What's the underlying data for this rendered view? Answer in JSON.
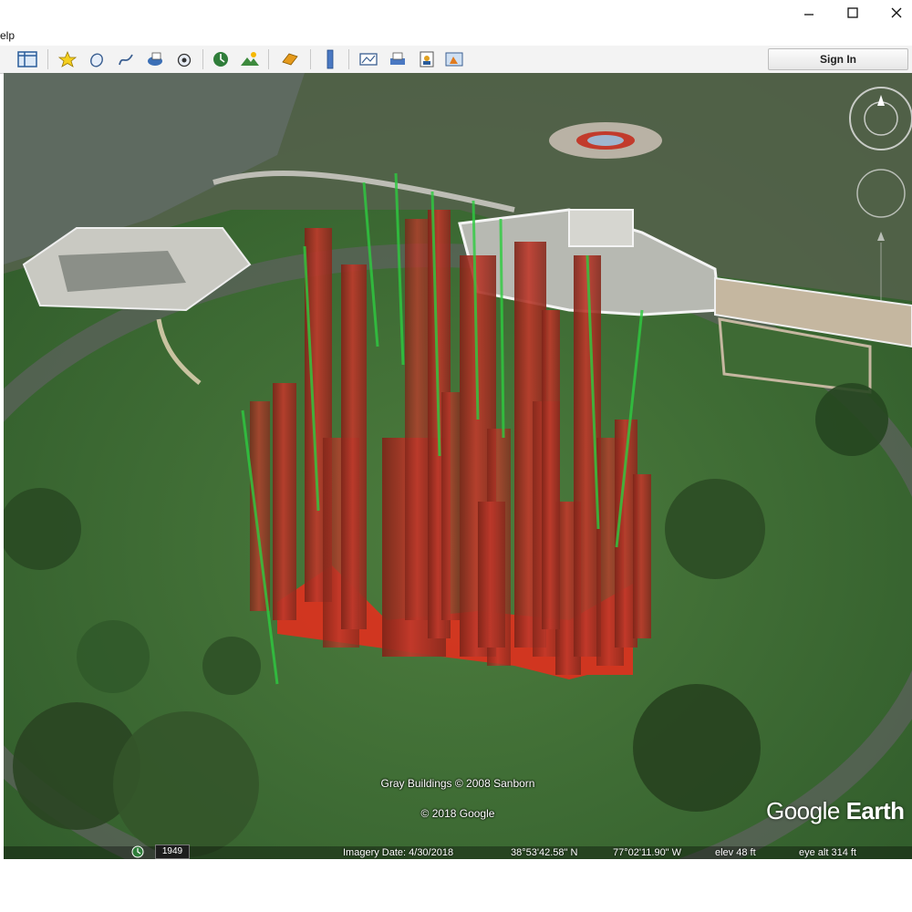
{
  "window": {
    "menu_fragment": "elp",
    "minimize_glyph": "—",
    "maximize_glyph": "☐",
    "close_glyph": "✕"
  },
  "toolbar": {
    "buttons": [
      {
        "icon": "sidebar-icon"
      },
      {
        "icon": "placemark-icon"
      },
      {
        "icon": "polygon-icon"
      },
      {
        "icon": "path-icon"
      },
      {
        "icon": "image-overlay-icon"
      },
      {
        "icon": "record-tour-icon"
      },
      {
        "icon": "historical-imagery-icon"
      },
      {
        "icon": "sunlight-icon"
      },
      {
        "icon": "switch-planet-icon"
      },
      {
        "icon": "ruler-icon"
      },
      {
        "icon": "email-icon"
      },
      {
        "icon": "print-icon"
      },
      {
        "icon": "save-image-icon"
      },
      {
        "icon": "view-in-maps-icon"
      }
    ],
    "sign_in_label": "Sign In"
  },
  "map": {
    "copyright_line1": "Gray Buildings © 2008 Sanborn",
    "copyright_line2": "© 2018 Google",
    "logo_word1": "Google",
    "logo_word2": "Earth",
    "year_badge": "1949",
    "imagery_date": "Imagery Date: 4/30/2018",
    "latitude": "38°53'42.58\" N",
    "longitude": "77°02'11.90\" W",
    "elevation": "elev   48 ft",
    "eye_alt": "eye alt   314 ft"
  },
  "colors": {
    "bar_red": "#c0392b",
    "bar_green": "#2ecc40",
    "grass": "#3f6b34"
  }
}
